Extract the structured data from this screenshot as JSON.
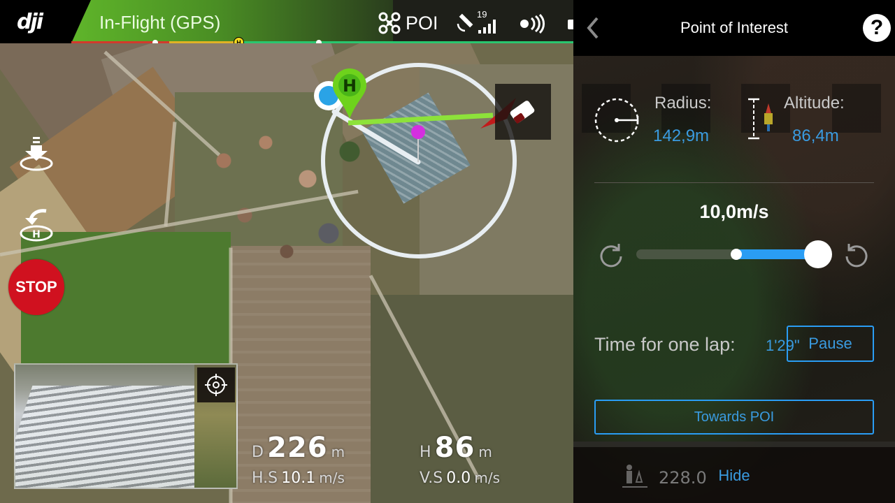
{
  "topbar": {
    "logo": "dji",
    "flight_status": "In-Flight (GPS)",
    "flight_mode": "POI",
    "satellite_count": "19",
    "status_colors": {
      "active": "#5fb52a",
      "battery_low": "#d33a2c",
      "battery_mid": "#e0b224",
      "battery_ok": "#29c66f"
    },
    "home_marker_label": "H"
  },
  "left_controls": {
    "takeoff_icon": "auto-takeoff-icon",
    "rth_icon": "return-to-home-icon",
    "stop_label": "STOP"
  },
  "map": {
    "home_label": "H",
    "icons": [
      "aircraft-position-icon",
      "home-point-icon",
      "poi-pin-icon",
      "eraser-icon",
      "orbit-circle"
    ]
  },
  "telemetry": {
    "distance_key": "D",
    "distance_value": "226",
    "distance_unit": "m",
    "height_key": "H",
    "height_value": "86",
    "height_unit": "m",
    "hspeed_key": "H.S",
    "hspeed_value": "10.1",
    "hspeed_unit": "m/s",
    "vspeed_key": "V.S",
    "vspeed_value": "0.0",
    "vspeed_unit": "m/s"
  },
  "panel": {
    "title": "Point of Interest",
    "help_label": "?",
    "radius_label": "Radius:",
    "radius_value": "142,9m",
    "altitude_label": "Altitude:",
    "altitude_value": "86,4m",
    "speed_value": "10,0m/s",
    "speed_slider_fraction": 0.5,
    "speed_slider_direction": "clockwise-to-counterclockwise",
    "lap_label": "Time for one lap:",
    "lap_value": "1'29\"",
    "pause_label": "Pause",
    "towards_label": "Towards POI",
    "hide_label": "Hide",
    "ghost_altitude_value": "228.0",
    "accent": "#2a9df4"
  }
}
